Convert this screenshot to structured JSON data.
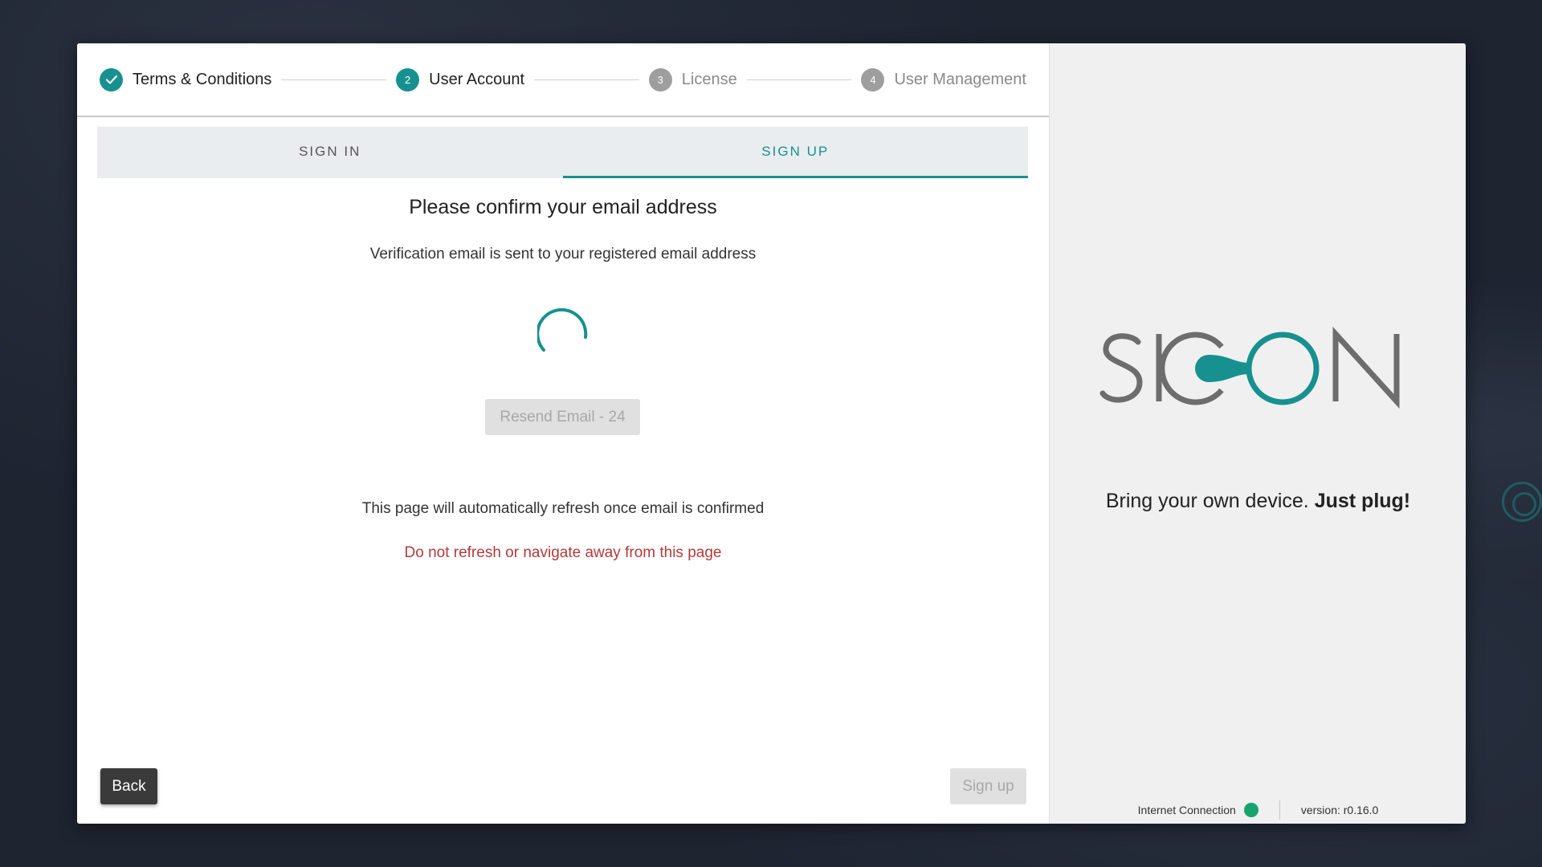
{
  "stepper": {
    "steps": [
      {
        "number": "",
        "label": "Terms & Conditions",
        "state": "done"
      },
      {
        "number": "2",
        "label": "User Account",
        "state": "active"
      },
      {
        "number": "3",
        "label": "License",
        "state": "todo"
      },
      {
        "number": "4",
        "label": "User Management",
        "state": "todo"
      }
    ]
  },
  "tabs": [
    {
      "label": "SIGN IN",
      "active": false
    },
    {
      "label": "SIGN UP",
      "active": true
    }
  ],
  "confirm": {
    "title": "Please confirm your email address",
    "subtitle": "Verification email is sent to your registered email address",
    "resend_label": "Resend Email - 24",
    "refresh_note": "This page will automatically refresh once email is confirmed",
    "warning": "Do not refresh or navigate away from this page"
  },
  "actions": {
    "back_label": "Back",
    "signup_label": "Sign up"
  },
  "brand": {
    "logo_text": "SICON",
    "tagline_prefix": "Bring your own device.",
    "tagline_bold": "Just plug!"
  },
  "status": {
    "connection_label": "Internet Connection",
    "connection_state": "online",
    "version_label": "version: r0.16.0"
  },
  "colors": {
    "accent": "#16918f",
    "warning": "#b33a3a",
    "online": "#17a36d"
  }
}
